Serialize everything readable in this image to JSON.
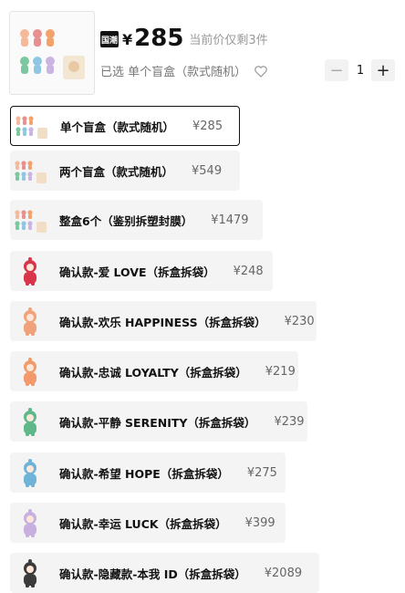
{
  "header": {
    "badge": "国潮",
    "currency": "¥",
    "price": "285",
    "stock_text": "当前价仅剩3件",
    "selected_text": "已选 单个盲盒（款式随机）",
    "qty": "1",
    "minus": "−",
    "plus": "+"
  },
  "options": [
    {
      "label": "单个盲盒（款式随机）",
      "price": "¥285",
      "selected": true,
      "icon": "bundle-thumb"
    },
    {
      "label": "两个盲盒（款式随机）",
      "price": "¥549",
      "selected": false,
      "icon": "bundle-thumb"
    },
    {
      "label": "整盒6个（鉴别拆塑封膜）",
      "price": "¥1479",
      "selected": false,
      "icon": "bundle-thumb"
    },
    {
      "label": "确认款-爱 LOVE（拆盒拆袋）",
      "price": "¥248",
      "selected": false,
      "icon": "figure-red",
      "color": "#d8344a"
    },
    {
      "label": "确认款-欢乐 HAPPINESS（拆盒拆袋）",
      "price": "¥230",
      "selected": false,
      "icon": "figure-peach",
      "color": "#f0a27a"
    },
    {
      "label": "确认款-忠诚 LOYALTY（拆盒拆袋）",
      "price": "¥219",
      "selected": false,
      "icon": "figure-orange",
      "color": "#f29a6a"
    },
    {
      "label": "确认款-平静 SERENITY（拆盒拆袋）",
      "price": "¥239",
      "selected": false,
      "icon": "figure-green",
      "color": "#5fb78a"
    },
    {
      "label": "确认款-希望 HOPE（拆盒拆袋）",
      "price": "¥275",
      "selected": false,
      "icon": "figure-blue",
      "color": "#6fb3d8"
    },
    {
      "label": "确认款-幸运 LUCK（拆盒拆袋）",
      "price": "¥399",
      "selected": false,
      "icon": "figure-lavender",
      "color": "#c7b0df"
    },
    {
      "label": "确认款-隐藏款-本我 ID（拆盒拆袋）",
      "price": "¥2089",
      "selected": false,
      "icon": "figure-dark",
      "color": "#3b3b3b"
    }
  ]
}
